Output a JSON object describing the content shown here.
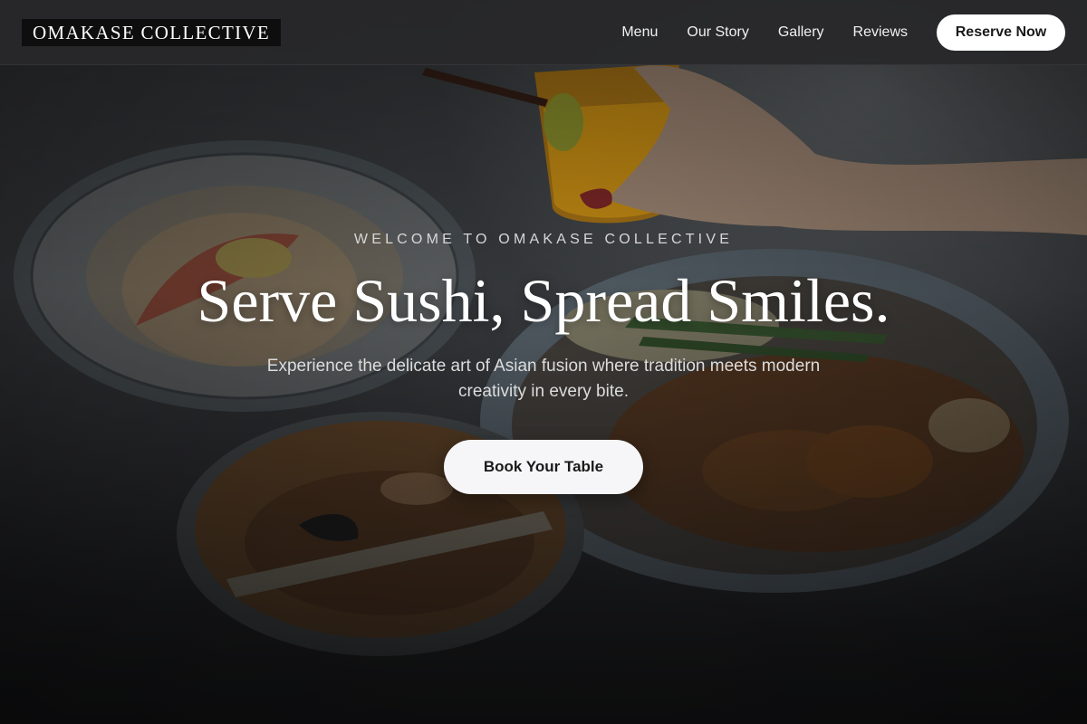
{
  "nav": {
    "brand": "OMAKASE COLLECTIVE",
    "links": [
      {
        "label": "Menu"
      },
      {
        "label": "Our Story"
      },
      {
        "label": "Gallery"
      },
      {
        "label": "Reviews"
      }
    ],
    "cta_label": "Reserve Now"
  },
  "hero": {
    "eyebrow": "WELCOME TO OMAKASE COLLECTIVE",
    "title": "Serve Sushi, Spread Smiles.",
    "subtitle": "Experience the delicate art of Asian fusion where tradition meets modern creativity in every bite.",
    "cta_label": "Book Your Table"
  },
  "colors": {
    "nav_background": "#28282a",
    "brand_background": "#0e0e0e",
    "button_background": "#ffffff",
    "button_text": "#1a1a1a",
    "hero_text": "#ffffff",
    "hero_muted_text": "#d6d6d6"
  }
}
